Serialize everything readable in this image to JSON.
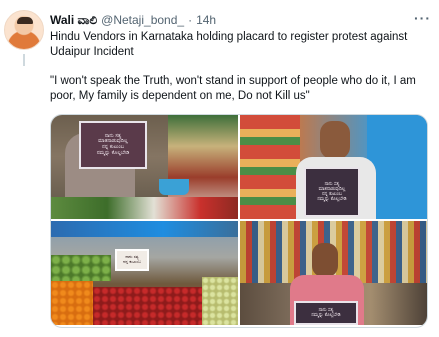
{
  "tweet": {
    "author_name": "Wali ವಾಲಿ",
    "author_handle": "@Netaji_bond_",
    "separator": "·",
    "time": "14h",
    "more_label": "···",
    "text": "Hindu Vendors in Karnataka holding placard to register protest against Udaipur Incident",
    "quote": "\"I won't speak the Truth, won't stand in support of people who do it, I am poor, My family is dependent on me, Do not Kill us\""
  },
  "colors": {
    "text_primary": "#0f1419",
    "text_secondary": "#536471",
    "border": "#cfd9de"
  },
  "media": {
    "placards": [
      {
        "lines": [
          "ನಾನು ಸತ್ಯ",
          "ಮಾತನಾಡುವುದಿಲ್ಲ",
          "ನನ್ನ ಕುಟುಂಬ",
          "ನಮ್ಮನ್ನು ಕೊಲ್ಲಬೇಡಿ"
        ]
      },
      {
        "lines": [
          "ನಾನು ಸತ್ಯ",
          "ಮಾತನಾಡುವುದಿಲ್ಲ",
          "ನನ್ನ ಕುಟುಂಬ",
          "ನಮ್ಮನ್ನು ಕೊಲ್ಲಬೇಡಿ"
        ]
      },
      {
        "lines": [
          "ನಾನು ಸತ್ಯ",
          "ನನ್ನ ಕುಟುಂಬ"
        ]
      },
      {
        "lines": [
          "ನಾನು ಸತ್ಯ",
          "ನಮ್ಮನ್ನು ಕೊಲ್ಲಬೇಡಿ"
        ]
      }
    ]
  }
}
